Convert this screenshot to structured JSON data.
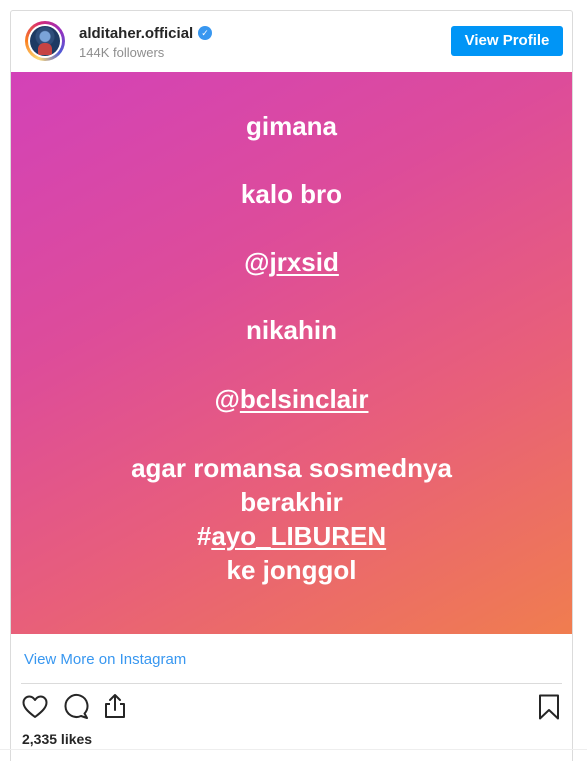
{
  "header": {
    "username": "alditaher.official",
    "followers": "144K followers",
    "view_profile_label": "View Profile"
  },
  "post": {
    "line1": "gimana",
    "line2": "kalo bro",
    "mention1_at": "@",
    "mention1": "jrxsid",
    "line4": "nikahin",
    "mention2_at": "@",
    "mention2": "bclsinclair",
    "line6a": "agar romansa sosmednya",
    "line6b": "berakhir",
    "hashtag_hash": "#",
    "hashtag": "ayo_LIBUREN",
    "line8": "ke jonggol"
  },
  "footer": {
    "view_more": "View More on Instagram",
    "likes": "2,335 likes"
  },
  "icons": {
    "verified": "verified-badge-icon",
    "like": "heart-icon",
    "comment": "comment-icon",
    "share": "share-icon",
    "save": "bookmark-icon"
  },
  "colors": {
    "accent": "#0095f6",
    "link": "#3897f0",
    "gradient_start": "#d342b8",
    "gradient_end": "#f07d4f"
  }
}
